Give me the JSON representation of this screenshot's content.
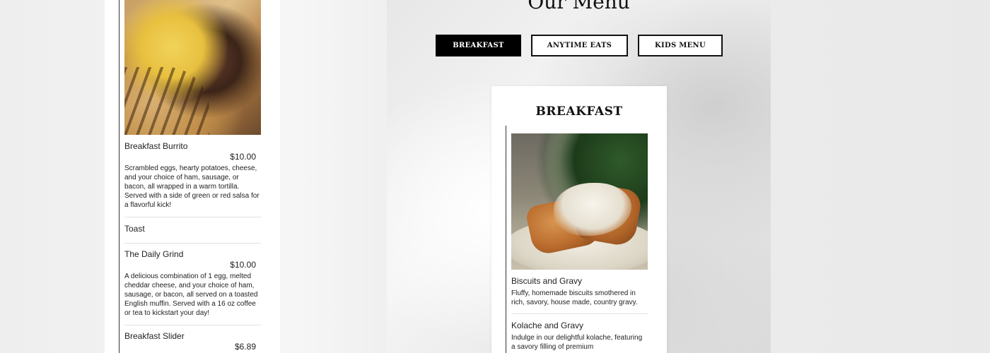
{
  "page": {
    "menu_title": "Our Menu"
  },
  "tabs": [
    {
      "label": "BREAKFAST",
      "active": true
    },
    {
      "label": "ANYTIME EATS",
      "active": false
    },
    {
      "label": "KIDS MENU",
      "active": false
    }
  ],
  "left_column": {
    "image_icon": "burrito-photo",
    "items": [
      {
        "name": "Breakfast Burrito",
        "price": "$10.00",
        "description": "Scrambled eggs, hearty potatoes, cheese, and your choice of ham, sausage, or bacon, all wrapped in a warm tortilla. Served with a side of green or red salsa for a flavorful kick!"
      },
      {
        "name": "Toast",
        "price": "",
        "description": ""
      },
      {
        "name": "The Daily Grind",
        "price": "$10.00",
        "description": "A delicious combination of 1 egg, melted cheddar cheese, and your choice of ham, sausage, or bacon, all served on a toasted English muffin. Served with a 16 oz coffee or tea to kickstart your day!"
      },
      {
        "name": "Breakfast Slider",
        "price": "$6.89",
        "description": ""
      }
    ]
  },
  "card": {
    "title": "BREAKFAST",
    "image_icon": "biscuits-and-gravy-photo",
    "items": [
      {
        "name": "Biscuits and Gravy",
        "description": "Fluffy, homemade biscuits smothered in rich, savory, house made, country gravy."
      },
      {
        "name": "Kolache and Gravy",
        "description": "Indulge in our delightful kolache, featuring a savory filling of premium"
      }
    ]
  }
}
